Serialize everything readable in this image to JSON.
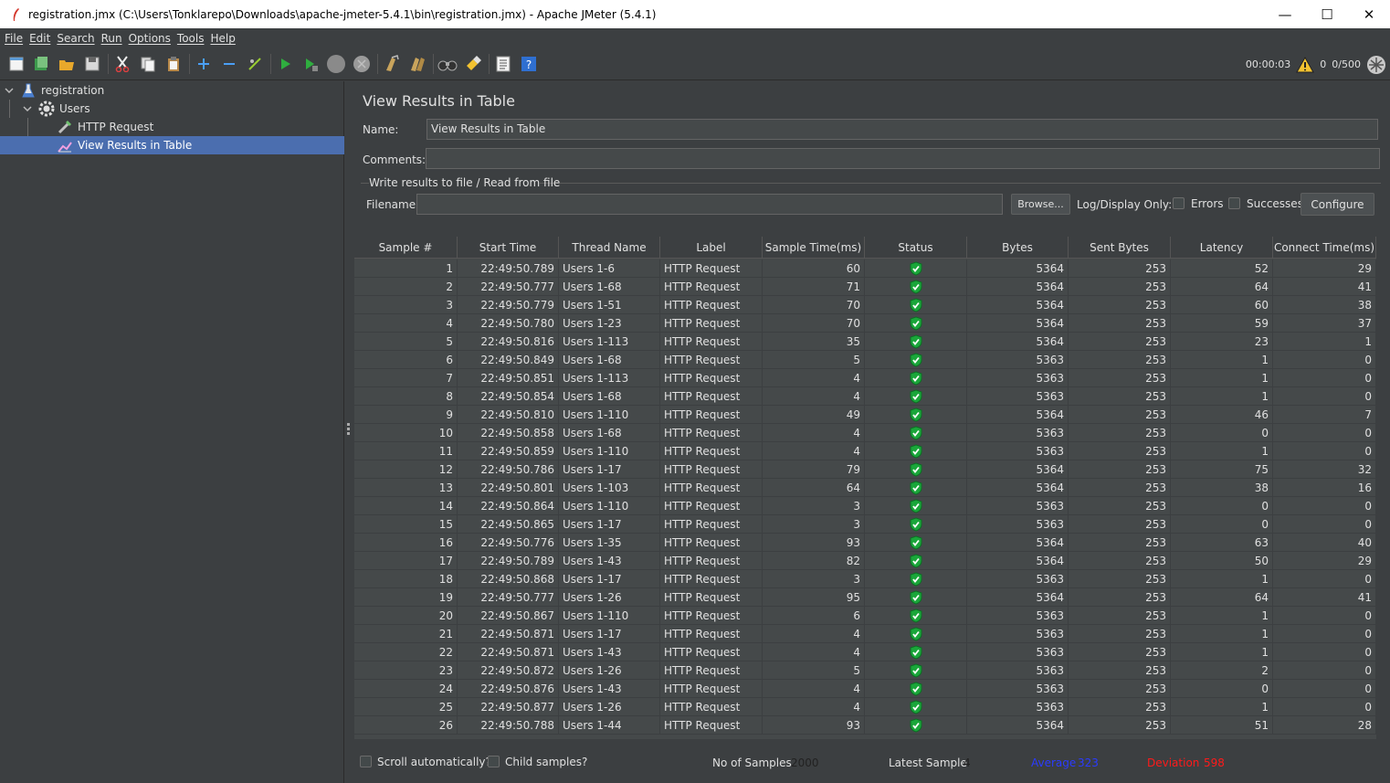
{
  "window": {
    "title": "registration.jmx (C:\\Users\\Tonklarepo\\Downloads\\apache-jmeter-5.4.1\\bin\\registration.jmx) - Apache JMeter (5.4.1)",
    "minimize": "—",
    "maximize": "☐",
    "close": "✕"
  },
  "menu": [
    "File",
    "Edit",
    "Search",
    "Run",
    "Options",
    "Tools",
    "Help"
  ],
  "toolbar": {
    "icons": [
      "new-icon",
      "templates-icon",
      "open-icon",
      "save-icon",
      "cut-icon",
      "copy-icon",
      "paste-icon",
      "expand-icon",
      "collapse-icon",
      "toggle-icon",
      "start-icon",
      "start-no-pause-icon",
      "stop-icon",
      "shutdown-icon",
      "clear-icon",
      "clear-all-icon",
      "search-icon",
      "reset-search-icon",
      "function-helper-icon",
      "help-icon"
    ],
    "elapsed": "00:00:03",
    "warnings": "0",
    "threads": "0/500"
  },
  "tree": {
    "root": "registration",
    "group": "Users",
    "sampler": "HTTP Request",
    "listener": "View Results in Table"
  },
  "panel": {
    "title": "View Results in Table",
    "name_label": "Name:",
    "name_value": "View Results in Table",
    "comments_label": "Comments:",
    "comments_value": "",
    "file_group": "Write results to file / Read from file",
    "filename_label": "Filename",
    "filename_value": "",
    "browse": "Browse...",
    "log_display_only": "Log/Display Only:",
    "errors": "Errors",
    "successes": "Successes",
    "configure": "Configure"
  },
  "table": {
    "columns": [
      "Sample #",
      "Start Time",
      "Thread Name",
      "Label",
      "Sample Time(ms)",
      "Status",
      "Bytes",
      "Sent Bytes",
      "Latency",
      "Connect Time(ms)"
    ],
    "rows": [
      [
        "1",
        "22:49:50.789",
        "Users 1-6",
        "HTTP Request",
        "60",
        "ok",
        "5364",
        "253",
        "52",
        "29"
      ],
      [
        "2",
        "22:49:50.777",
        "Users 1-68",
        "HTTP Request",
        "71",
        "ok",
        "5364",
        "253",
        "64",
        "41"
      ],
      [
        "3",
        "22:49:50.779",
        "Users 1-51",
        "HTTP Request",
        "70",
        "ok",
        "5364",
        "253",
        "60",
        "38"
      ],
      [
        "4",
        "22:49:50.780",
        "Users 1-23",
        "HTTP Request",
        "70",
        "ok",
        "5364",
        "253",
        "59",
        "37"
      ],
      [
        "5",
        "22:49:50.816",
        "Users 1-113",
        "HTTP Request",
        "35",
        "ok",
        "5364",
        "253",
        "23",
        "1"
      ],
      [
        "6",
        "22:49:50.849",
        "Users 1-68",
        "HTTP Request",
        "5",
        "ok",
        "5363",
        "253",
        "1",
        "0"
      ],
      [
        "7",
        "22:49:50.851",
        "Users 1-113",
        "HTTP Request",
        "4",
        "ok",
        "5363",
        "253",
        "1",
        "0"
      ],
      [
        "8",
        "22:49:50.854",
        "Users 1-68",
        "HTTP Request",
        "4",
        "ok",
        "5363",
        "253",
        "1",
        "0"
      ],
      [
        "9",
        "22:49:50.810",
        "Users 1-110",
        "HTTP Request",
        "49",
        "ok",
        "5364",
        "253",
        "46",
        "7"
      ],
      [
        "10",
        "22:49:50.858",
        "Users 1-68",
        "HTTP Request",
        "4",
        "ok",
        "5363",
        "253",
        "0",
        "0"
      ],
      [
        "11",
        "22:49:50.859",
        "Users 1-110",
        "HTTP Request",
        "4",
        "ok",
        "5363",
        "253",
        "1",
        "0"
      ],
      [
        "12",
        "22:49:50.786",
        "Users 1-17",
        "HTTP Request",
        "79",
        "ok",
        "5364",
        "253",
        "75",
        "32"
      ],
      [
        "13",
        "22:49:50.801",
        "Users 1-103",
        "HTTP Request",
        "64",
        "ok",
        "5364",
        "253",
        "38",
        "16"
      ],
      [
        "14",
        "22:49:50.864",
        "Users 1-110",
        "HTTP Request",
        "3",
        "ok",
        "5363",
        "253",
        "0",
        "0"
      ],
      [
        "15",
        "22:49:50.865",
        "Users 1-17",
        "HTTP Request",
        "3",
        "ok",
        "5363",
        "253",
        "0",
        "0"
      ],
      [
        "16",
        "22:49:50.776",
        "Users 1-35",
        "HTTP Request",
        "93",
        "ok",
        "5364",
        "253",
        "63",
        "40"
      ],
      [
        "17",
        "22:49:50.789",
        "Users 1-43",
        "HTTP Request",
        "82",
        "ok",
        "5364",
        "253",
        "50",
        "29"
      ],
      [
        "18",
        "22:49:50.868",
        "Users 1-17",
        "HTTP Request",
        "3",
        "ok",
        "5363",
        "253",
        "1",
        "0"
      ],
      [
        "19",
        "22:49:50.777",
        "Users 1-26",
        "HTTP Request",
        "95",
        "ok",
        "5364",
        "253",
        "64",
        "41"
      ],
      [
        "20",
        "22:49:50.867",
        "Users 1-110",
        "HTTP Request",
        "6",
        "ok",
        "5363",
        "253",
        "1",
        "0"
      ],
      [
        "21",
        "22:49:50.871",
        "Users 1-17",
        "HTTP Request",
        "4",
        "ok",
        "5363",
        "253",
        "1",
        "0"
      ],
      [
        "22",
        "22:49:50.871",
        "Users 1-43",
        "HTTP Request",
        "4",
        "ok",
        "5363",
        "253",
        "1",
        "0"
      ],
      [
        "23",
        "22:49:50.872",
        "Users 1-26",
        "HTTP Request",
        "5",
        "ok",
        "5363",
        "253",
        "2",
        "0"
      ],
      [
        "24",
        "22:49:50.876",
        "Users 1-43",
        "HTTP Request",
        "4",
        "ok",
        "5363",
        "253",
        "0",
        "0"
      ],
      [
        "25",
        "22:49:50.877",
        "Users 1-26",
        "HTTP Request",
        "4",
        "ok",
        "5363",
        "253",
        "1",
        "0"
      ],
      [
        "26",
        "22:49:50.788",
        "Users 1-44",
        "HTTP Request",
        "93",
        "ok",
        "5364",
        "253",
        "51",
        "28"
      ]
    ]
  },
  "footer": {
    "scroll_auto": "Scroll automatically?",
    "child_samples": "Child samples?",
    "no_samples_label": "No of Samples",
    "no_samples_value": "2000",
    "latest_label": "Latest Sample",
    "latest_value": "4",
    "average_label": "Average",
    "average_value": "323",
    "deviation_label": "Deviation",
    "deviation_value": "598"
  },
  "colors": {
    "selection": "#4b6eaf",
    "status_ok": "#1aa63a",
    "average": "#2b3bff",
    "deviation": "#ff1a1a"
  }
}
